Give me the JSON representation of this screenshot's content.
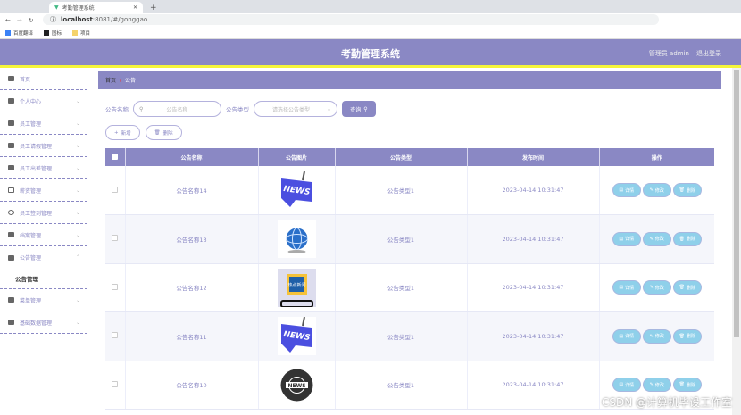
{
  "browser": {
    "tab_title": "考勤管理系统",
    "url_host": "localhost",
    "url_rest": ":8081/#/gonggao",
    "bookmarks": [
      "百度翻译",
      "图标",
      "项目"
    ]
  },
  "header": {
    "title": "考勤管理系统",
    "user": "管理员 admin",
    "logout": "退出登录"
  },
  "sidebar": {
    "items": [
      {
        "label": "首页"
      },
      {
        "label": "个人中心"
      },
      {
        "label": "员工管理"
      },
      {
        "label": "员工请假管理"
      },
      {
        "label": "员工出差管理"
      },
      {
        "label": "薪资管理"
      },
      {
        "label": "员工签到管理"
      },
      {
        "label": "档案管理"
      },
      {
        "label": "公告管理"
      },
      {
        "label": "菜单管理"
      },
      {
        "label": "基础数据管理"
      }
    ],
    "sub": "公告管理"
  },
  "breadcrumb": {
    "home": "首页",
    "sep": "/",
    "current": "公告"
  },
  "search": {
    "name_label": "公告名称",
    "name_placeholder": "公告名称",
    "type_label": "公告类型",
    "type_placeholder": "请选择公告类型",
    "query": "查询"
  },
  "actions": {
    "add": "新增",
    "delete": "删除"
  },
  "table": {
    "headers": [
      "公告名称",
      "公告图片",
      "公告类型",
      "发布时间",
      "操作"
    ],
    "rows": [
      {
        "name": "公告名称14",
        "image": "NEWS",
        "type": "公告类型1",
        "time": "2023-04-14 10:31:47"
      },
      {
        "name": "公告名称13",
        "image": "globe",
        "type": "公告类型1",
        "time": "2023-04-14 10:31:47"
      },
      {
        "name": "公告名称12",
        "image": "热点新闻",
        "type": "公告类型1",
        "time": "2023-04-14 10:31:47"
      },
      {
        "name": "公告名称11",
        "image": "NEWS",
        "type": "公告类型1",
        "time": "2023-04-14 10:31:47"
      },
      {
        "name": "公告名称10",
        "image": "NEWS",
        "type": "公告类型1",
        "time": "2023-04-14 10:31:47"
      }
    ],
    "ops": {
      "detail": "详情",
      "edit": "修改",
      "delete": "删除"
    }
  },
  "watermark": "CSDN @计算机毕设工作室",
  "colors": {
    "primary": "#8a88c4",
    "accent": "#f5f53a",
    "op": "#8fd0ea"
  }
}
